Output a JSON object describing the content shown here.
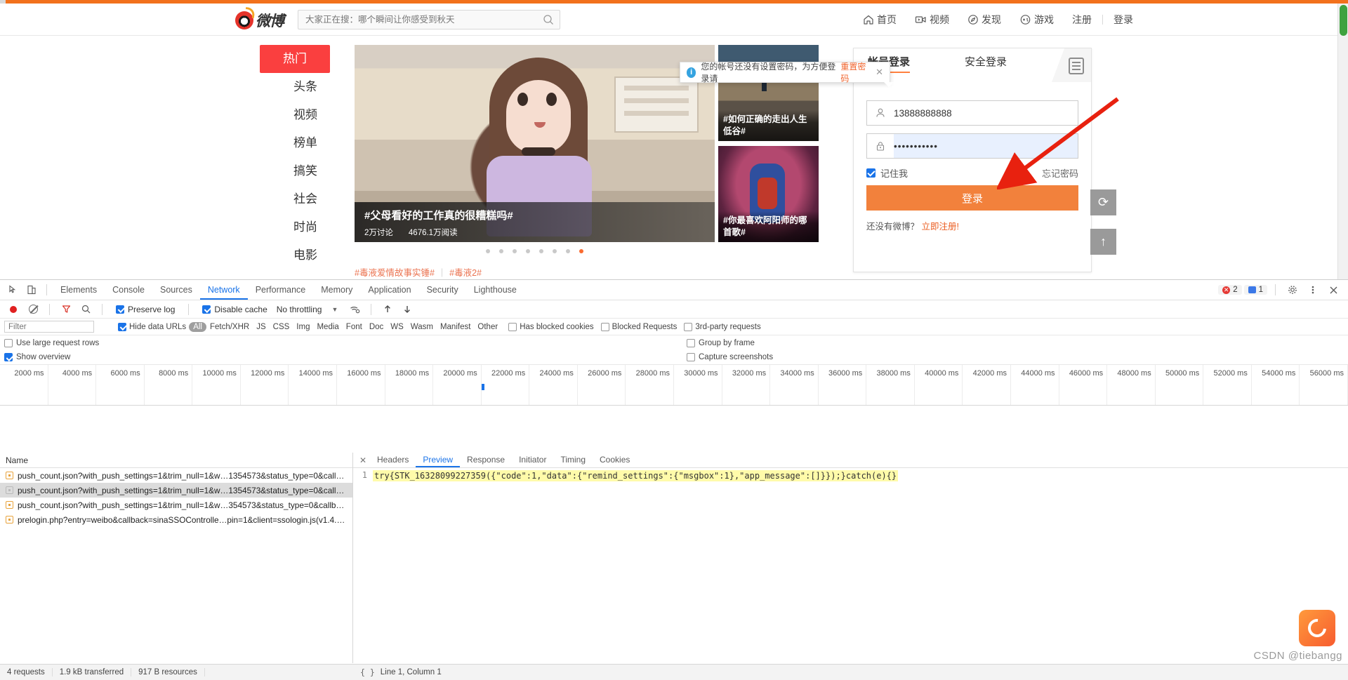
{
  "browser": {
    "page": {
      "logo_text": "微博",
      "search_placeholder": "大家正在搜：哪个瞬间让你感受到秋天",
      "nav": [
        {
          "label": "首页",
          "icon": "home-icon"
        },
        {
          "label": "视频",
          "icon": "video-icon"
        },
        {
          "label": "发现",
          "icon": "compass-icon"
        },
        {
          "label": "游戏",
          "icon": "gamepad-icon"
        }
      ],
      "auth": {
        "register": "注册",
        "login": "登录"
      },
      "hot_tabs": [
        {
          "label": "热门",
          "active": true
        },
        {
          "label": "头条",
          "active": false
        },
        {
          "label": "视频",
          "active": false
        },
        {
          "label": "榜单",
          "active": false
        },
        {
          "label": "搞笑",
          "active": false
        },
        {
          "label": "社会",
          "active": false
        },
        {
          "label": "时尚",
          "active": false
        },
        {
          "label": "电影",
          "active": false
        }
      ],
      "hero": {
        "title": "#父母看好的工作真的很糟糕吗#",
        "discussions": "2万讨论",
        "reads": "4676.1万阅读",
        "dot_count": 8,
        "active_dot": 8
      },
      "cards": [
        {
          "caption": "#如何正确的走出人生低谷#"
        },
        {
          "caption": "#你最喜欢阿阳师的哪首歌#"
        }
      ],
      "hot_tags": [
        "#毒液爱情故事实锤#",
        "#毒液2#"
      ],
      "login_box": {
        "tabs": [
          {
            "label": "帐号登录",
            "active": true
          },
          {
            "label": "安全登录",
            "active": false
          }
        ],
        "qr_icon": "qr-code-icon",
        "username_value": "13888888888",
        "username_icon": "user-icon",
        "password_value": "•••••••••••",
        "password_icon": "lock-icon",
        "remember_label": "记住我",
        "forgot_label": "忘记密码",
        "login_button": "登录",
        "signup_prefix": "还没有微博？",
        "signup_link": "立即注册!"
      },
      "tooltip": {
        "text": "您的帐号还没有设置密码，为方便登录请",
        "link": "重置密码",
        "close": "✕",
        "icon": "info-icon"
      },
      "float_buttons": [
        {
          "icon": "refresh-icon",
          "glyph": "⟳"
        },
        {
          "icon": "back-to-top-icon",
          "glyph": "↑"
        }
      ]
    }
  },
  "devtools": {
    "tabs": [
      {
        "label": "Elements",
        "active": false
      },
      {
        "label": "Console",
        "active": false
      },
      {
        "label": "Sources",
        "active": false
      },
      {
        "label": "Network",
        "active": true
      },
      {
        "label": "Performance",
        "active": false
      },
      {
        "label": "Memory",
        "active": false
      },
      {
        "label": "Application",
        "active": false
      },
      {
        "label": "Security",
        "active": false
      },
      {
        "label": "Lighthouse",
        "active": false
      }
    ],
    "left_icons": [
      "inspect-element-icon",
      "device-toolbar-icon"
    ],
    "counters": {
      "errors": "2",
      "messages": "1"
    },
    "right_icons": [
      "gear-icon",
      "kebab-menu-icon",
      "close-icon"
    ],
    "toolbar": {
      "record_icon": "record-icon",
      "clear_icon": "clear-icon",
      "filter_icon": "filter-icon",
      "search_icon": "search-icon",
      "preserve_log": "Preserve log",
      "preserve_log_checked": true,
      "disable_cache": "Disable cache",
      "disable_cache_checked": true,
      "throttling": "No throttling",
      "wifi_icon": "network-conditions-icon",
      "import_icon": "import-har-icon",
      "export_icon": "export-har-icon"
    },
    "filterbar": {
      "filter_placeholder": "Filter",
      "hide_data_urls": "Hide data URLs",
      "hide_data_urls_checked": true,
      "types": [
        "All",
        "Fetch/XHR",
        "JS",
        "CSS",
        "Img",
        "Media",
        "Font",
        "Doc",
        "WS",
        "Wasm",
        "Manifest",
        "Other"
      ],
      "active_type": "All",
      "checks": [
        {
          "label": "Has blocked cookies",
          "checked": false
        },
        {
          "label": "Blocked Requests",
          "checked": false
        },
        {
          "label": "3rd-party requests",
          "checked": false
        }
      ]
    },
    "options": [
      {
        "label": "Use large request rows",
        "checked": false
      },
      {
        "label": "Group by frame",
        "checked": false
      },
      {
        "label": "Show overview",
        "checked": true
      },
      {
        "label": "Capture screenshots",
        "checked": false
      }
    ],
    "overview_ticks": [
      "2000 ms",
      "4000 ms",
      "6000 ms",
      "8000 ms",
      "10000 ms",
      "12000 ms",
      "14000 ms",
      "16000 ms",
      "18000 ms",
      "20000 ms",
      "22000 ms",
      "24000 ms",
      "26000 ms",
      "28000 ms",
      "30000 ms",
      "32000 ms",
      "34000 ms",
      "36000 ms",
      "38000 ms",
      "40000 ms",
      "42000 ms",
      "44000 ms",
      "46000 ms",
      "48000 ms",
      "50000 ms",
      "52000 ms",
      "54000 ms",
      "56000 ms"
    ],
    "requests_header": "Name",
    "requests": [
      {
        "name": "push_count.json?with_push_settings=1&trim_null=1&w…1354573&status_type=0&call…",
        "selected": false
      },
      {
        "name": "push_count.json?with_push_settings=1&trim_null=1&w…1354573&status_type=0&call…",
        "selected": true
      },
      {
        "name": "push_count.json?with_push_settings=1&trim_null=1&w…354573&status_type=0&callb…",
        "selected": false
      },
      {
        "name": "prelogin.php?entry=weibo&callback=sinaSSOControlle…pin=1&client=ssologin.js(v1.4.…",
        "selected": false
      }
    ],
    "detail_tabs": [
      {
        "label": "Headers",
        "active": false
      },
      {
        "label": "Preview",
        "active": true
      },
      {
        "label": "Response",
        "active": false
      },
      {
        "label": "Initiator",
        "active": false
      },
      {
        "label": "Timing",
        "active": false
      },
      {
        "label": "Cookies",
        "active": false
      }
    ],
    "preview": {
      "line_number": "1",
      "content": "try{STK_16328099227359({\"code\":1,\"data\":{\"remind_settings\":{\"msgbox\":1},\"app_message\":[]}});}catch(e){}"
    },
    "status": {
      "requests": "4 requests",
      "transferred": "1.9 kB transferred",
      "resources": "917 B resources",
      "cursor": "Line 1, Column 1",
      "format_icon": "pretty-print-icon"
    }
  },
  "watermark": {
    "text": "CSDN @tiebangg"
  },
  "colors": {
    "accent": "#1a73e8",
    "weibo_red": "#fa3f3f",
    "login_orange": "#f2813c",
    "arrow_red": "#e8210f"
  }
}
